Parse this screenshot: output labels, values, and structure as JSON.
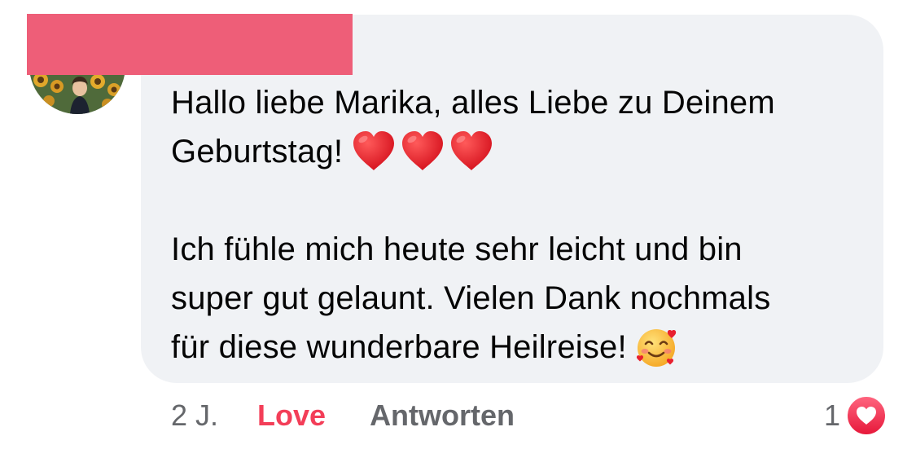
{
  "comment": {
    "author_redacted": true,
    "paragraphs": [
      [
        "Hallo liebe Marika, alles Liebe zu Deinem",
        "Geburtstag!"
      ],
      [
        "Ich fühle mich heute sehr leicht und bin",
        "super gut gelaunt. Vielen Dank nochmals",
        "für diese wunderbare Heilreise!"
      ]
    ],
    "emoji": {
      "after_paragraph_1": [
        "red-heart",
        "red-heart",
        "red-heart"
      ],
      "after_paragraph_2": [
        "smiling-face-with-hearts"
      ]
    }
  },
  "actions": {
    "timestamp": "2 J.",
    "love_label": "Love",
    "reply_label": "Antworten"
  },
  "reactions": {
    "count": "1",
    "type": "love-icon"
  },
  "colors": {
    "bubble": "#f0f2f5",
    "text": "#050505",
    "secondary_text": "#65676b",
    "love": "#f33e58",
    "redaction": "#ee5e78"
  }
}
